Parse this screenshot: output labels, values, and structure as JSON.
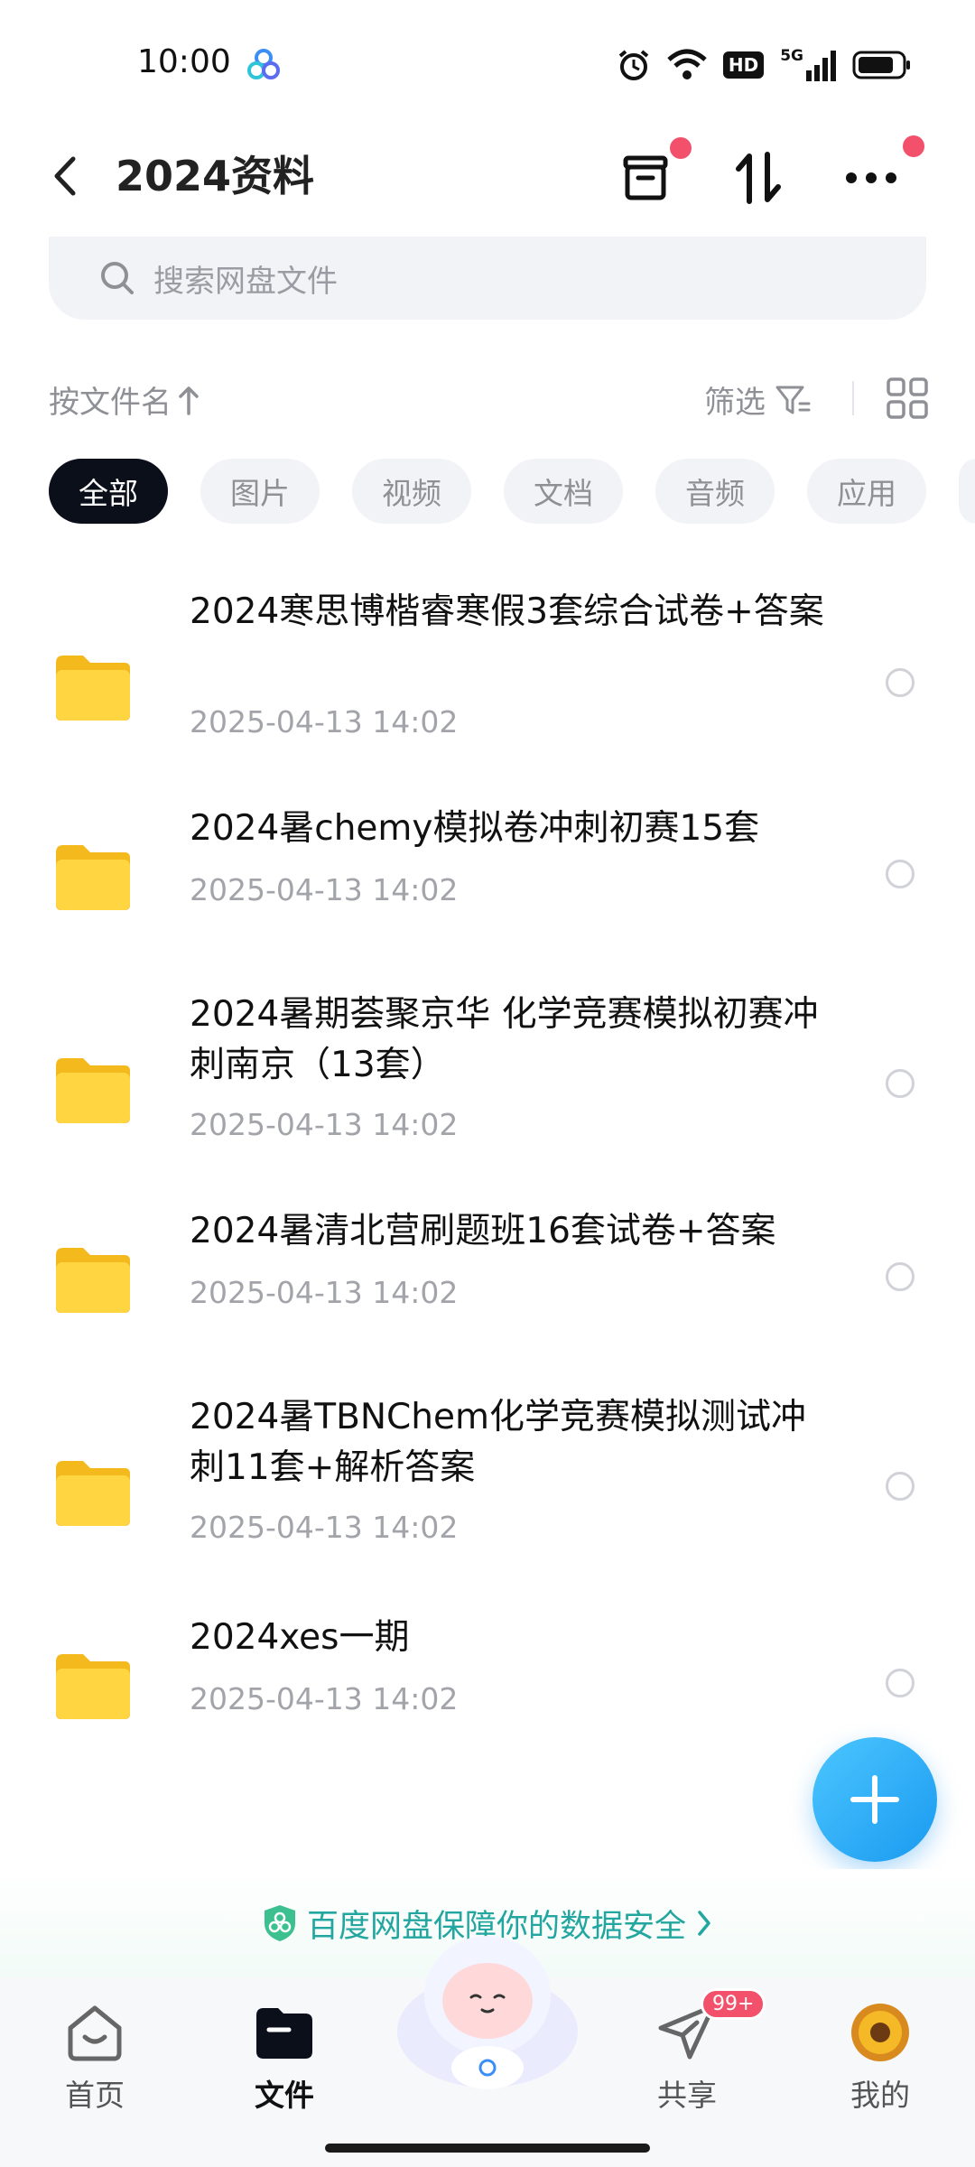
{
  "status_bar": {
    "time": "10:00",
    "hd_label": "HD",
    "network_label": "5G"
  },
  "header": {
    "title": "2024资料",
    "back_icon": "chevron-left-icon",
    "actions": [
      {
        "name": "archive-icon",
        "has_badge": true
      },
      {
        "name": "transfer-icon",
        "has_badge": false
      },
      {
        "name": "more-icon",
        "has_badge": true
      }
    ]
  },
  "search": {
    "placeholder": "搜索网盘文件"
  },
  "sort": {
    "label": "按文件名",
    "filter_label": "筛选"
  },
  "chips": [
    {
      "label": "全部",
      "active": true
    },
    {
      "label": "图片",
      "active": false
    },
    {
      "label": "视频",
      "active": false
    },
    {
      "label": "文档",
      "active": false
    },
    {
      "label": "音频",
      "active": false
    },
    {
      "label": "应用",
      "active": false
    }
  ],
  "files": [
    {
      "name": "2024寒思博楷睿寒假3套综合试卷+答案",
      "date": "2025-04-13  14:02"
    },
    {
      "name": "2024暑chemy模拟卷冲刺初赛15套",
      "date": "2025-04-13  14:02"
    },
    {
      "name": "2024暑期荟聚京华 化学竞赛模拟初赛冲刺南京（13套）",
      "date": "2025-04-13  14:02"
    },
    {
      "name": "2024暑清北营刷题班16套试卷+答案",
      "date": "2025-04-13  14:02"
    },
    {
      "name": "2024暑TBNChem化学竞赛模拟测试冲刺11套+解析答案",
      "date": "2025-04-13  14:02"
    },
    {
      "name": "2024xes一期",
      "date": "2025-04-13  14:02"
    }
  ],
  "banner": {
    "text": "百度网盘保障你的数据安全"
  },
  "bottom_nav": [
    {
      "label": "首页",
      "icon": "home-icon",
      "active": false
    },
    {
      "label": "文件",
      "icon": "folder-icon",
      "active": true
    },
    {
      "label": "共享",
      "icon": "share-icon",
      "active": false,
      "badge": "99+"
    },
    {
      "label": "我的",
      "icon": "avatar-icon",
      "active": false
    }
  ],
  "colors": {
    "accent": "#1a9af0",
    "badge": "#f2506b",
    "folder": "#f7c930",
    "banner_text": "#23a6a0"
  }
}
